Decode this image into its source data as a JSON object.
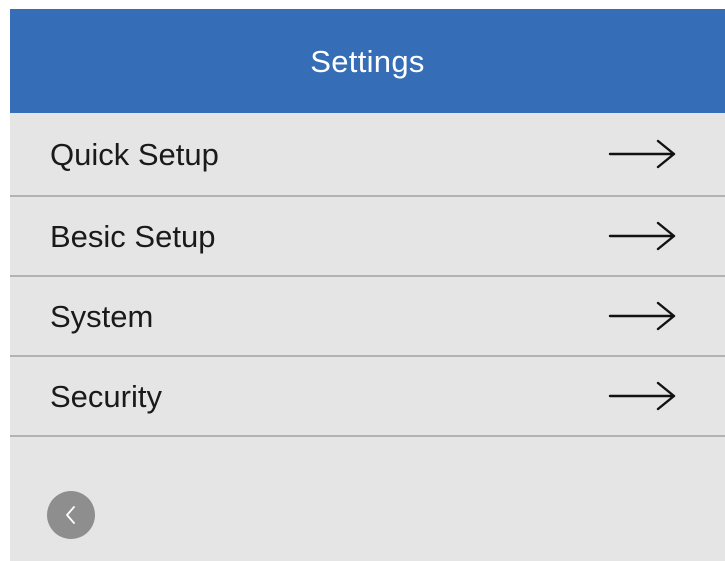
{
  "header": {
    "title": "Settings"
  },
  "menu": {
    "items": [
      {
        "label": "Quick Setup",
        "icon": "arrow-right-icon"
      },
      {
        "label": "Besic Setup",
        "icon": "arrow-right-icon"
      },
      {
        "label": "System",
        "icon": "arrow-right-icon"
      },
      {
        "label": "Security",
        "icon": "arrow-right-icon"
      }
    ]
  },
  "footer": {
    "back_icon": "chevron-left-icon"
  },
  "colors": {
    "header_bg": "#356db6",
    "panel_bg": "#e5e5e5",
    "divider": "#b3b3b3",
    "back_button_bg": "#8e8e8e"
  }
}
